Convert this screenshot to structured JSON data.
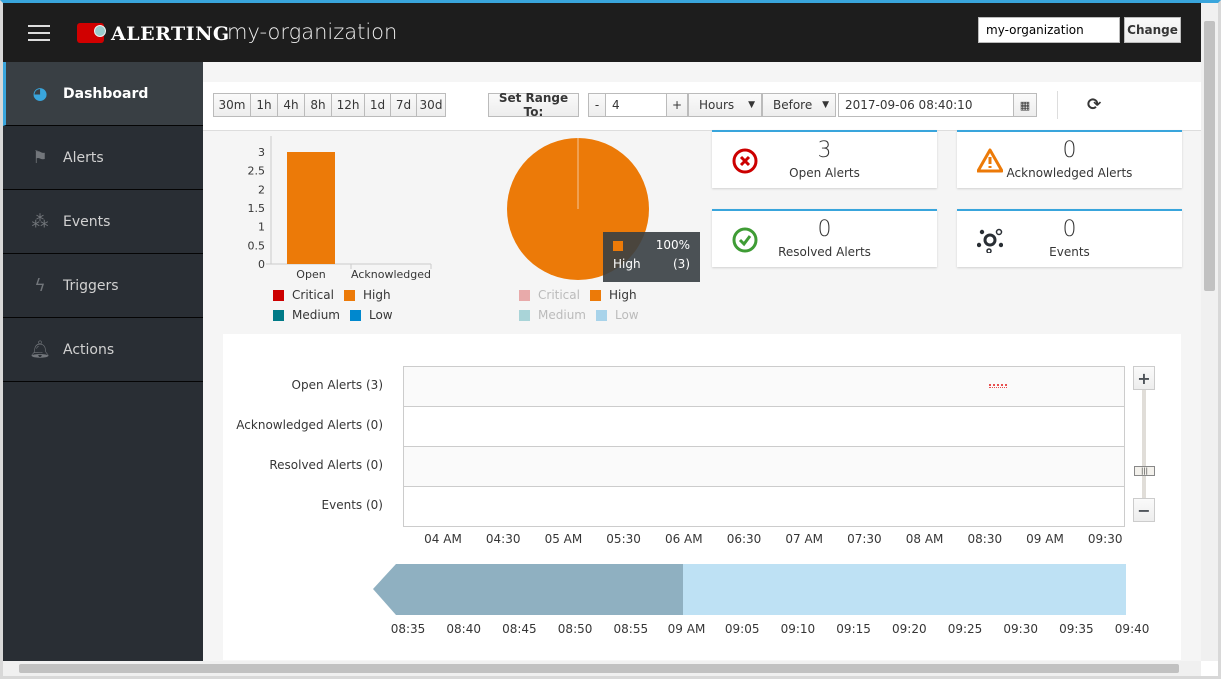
{
  "header": {
    "brand": "ALERTING",
    "org": "my-organization",
    "org_input": "my-organization",
    "change_label": "Change"
  },
  "sidebar": {
    "items": [
      {
        "label": "Dashboard",
        "icon": "dashboard-icon",
        "active": true
      },
      {
        "label": "Alerts",
        "icon": "flag-icon"
      },
      {
        "label": "Events",
        "icon": "network-icon"
      },
      {
        "label": "Triggers",
        "icon": "bolt-icon"
      },
      {
        "label": "Actions",
        "icon": "bell-icon"
      }
    ]
  },
  "toolbar": {
    "ranges": [
      "30m",
      "1h",
      "4h",
      "8h",
      "12h",
      "1d",
      "7d",
      "30d"
    ],
    "set_range_label": "Set Range To:",
    "minus": "-",
    "plus": "+",
    "amount": "4",
    "unit": "Hours",
    "direction": "Before",
    "datetime": "2017-09-06 08:40:10"
  },
  "cards": [
    {
      "value": "3",
      "label": "Open Alerts",
      "icon": "error-circle-icon",
      "color": "#cc0000"
    },
    {
      "value": "0",
      "label": "Acknowledged Alerts",
      "icon": "warning-triangle-icon",
      "color": "#ec7a08"
    },
    {
      "value": "0",
      "label": "Resolved Alerts",
      "icon": "ok-circle-icon",
      "color": "#3f9c35"
    },
    {
      "value": "0",
      "label": "Events",
      "icon": "network-icon",
      "color": "#292e34"
    }
  ],
  "legend": [
    {
      "name": "Critical",
      "color": "#cc0000"
    },
    {
      "name": "High",
      "color": "#ec7a08"
    },
    {
      "name": "Medium",
      "color": "#007a87"
    },
    {
      "name": "Low",
      "color": "#0088ce"
    }
  ],
  "chart_data": [
    {
      "type": "bar",
      "categories": [
        "Open",
        "Acknowledged"
      ],
      "series": [
        {
          "name": "High",
          "values": [
            3,
            0
          ]
        }
      ],
      "ylim": [
        0,
        3
      ],
      "yticks": [
        "0",
        "0.5",
        "1",
        "1.5",
        "2",
        "2.5",
        "3"
      ]
    },
    {
      "type": "pie",
      "slices": [
        {
          "name": "High",
          "value": 3,
          "percent": 100
        }
      ],
      "tooltip": {
        "percent": "100%",
        "name": "High",
        "count": "(3)"
      },
      "inactive_legend": [
        "Critical",
        "Medium",
        "Low"
      ]
    }
  ],
  "timeline": {
    "rows": [
      "Open Alerts (3)",
      "Acknowledged Alerts (0)",
      "Resolved Alerts (0)",
      "Events (0)"
    ],
    "ticks": [
      "04 AM",
      "04:30",
      "05 AM",
      "05:30",
      "06 AM",
      "06:30",
      "07 AM",
      "07:30",
      "08 AM",
      "08:30",
      "09 AM",
      "09:30"
    ],
    "zoom_in": "+",
    "zoom_out": "−",
    "nav_ticks": [
      "08:35",
      "08:40",
      "08:45",
      "08:50",
      "08:55",
      "09 AM",
      "09:05",
      "09:10",
      "09:15",
      "09:20",
      "09:25",
      "09:30",
      "09:35",
      "09:40"
    ]
  }
}
